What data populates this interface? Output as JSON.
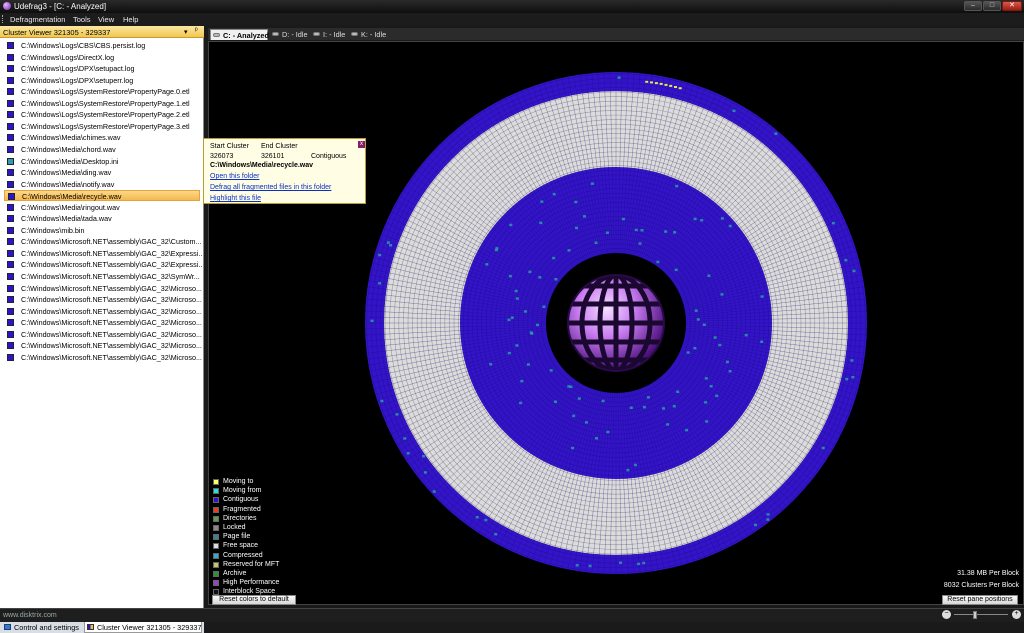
{
  "window": {
    "title": "Udefrag3 - [C: - Analyzed]",
    "min": "–",
    "max": "□",
    "close": "✕",
    "icon": "app-sphere-icon"
  },
  "menu": [
    "Defragmentation",
    "Tools",
    "View",
    "Help"
  ],
  "leftpane": {
    "title": "Cluster Viewer  321305 - 329337",
    "dropdown": "▾",
    "pin": "ᵖ",
    "files": [
      {
        "name": "C:\\Windows\\Logs\\CBS\\CBS.persist.log",
        "color": "#2b14c9"
      },
      {
        "name": "C:\\Windows\\Logs\\DirectX.log",
        "color": "#2b14c9"
      },
      {
        "name": "C:\\Windows\\Logs\\DPX\\setupact.log",
        "color": "#2b14c9"
      },
      {
        "name": "C:\\Windows\\Logs\\DPX\\setuperr.log",
        "color": "#2b14c9"
      },
      {
        "name": "C:\\Windows\\Logs\\SystemRestore\\PropertyPage.0.etl",
        "color": "#2b14c9"
      },
      {
        "name": "C:\\Windows\\Logs\\SystemRestore\\PropertyPage.1.etl",
        "color": "#2b14c9"
      },
      {
        "name": "C:\\Windows\\Logs\\SystemRestore\\PropertyPage.2.etl",
        "color": "#2b14c9"
      },
      {
        "name": "C:\\Windows\\Logs\\SystemRestore\\PropertyPage.3.etl",
        "color": "#2b14c9"
      },
      {
        "name": "C:\\Windows\\Media\\chimes.wav",
        "color": "#2b14c9"
      },
      {
        "name": "C:\\Windows\\Media\\chord.wav",
        "color": "#2b14c9"
      },
      {
        "name": "C:\\Windows\\Media\\Desktop.ini",
        "color": "#2a9fa8"
      },
      {
        "name": "C:\\Windows\\Media\\ding.wav",
        "color": "#2b14c9"
      },
      {
        "name": "C:\\Windows\\Media\\notify.wav",
        "color": "#2b14c9"
      },
      {
        "name": "C:\\Windows\\Media\\recycle.wav",
        "color": "#2b14c9"
      },
      {
        "name": "C:\\Windows\\Media\\ringout.wav",
        "color": "#2b14c9"
      },
      {
        "name": "C:\\Windows\\Media\\tada.wav",
        "color": "#2b14c9"
      },
      {
        "name": "C:\\Windows\\mib.bin",
        "color": "#2b14c9"
      },
      {
        "name": "C:\\Windows\\Microsoft.NET\\assembly\\GAC_32\\Custom...",
        "color": "#2b14c9"
      },
      {
        "name": "C:\\Windows\\Microsoft.NET\\assembly\\GAC_32\\Expressi...",
        "color": "#2b14c9"
      },
      {
        "name": "C:\\Windows\\Microsoft.NET\\assembly\\GAC_32\\Expressi...",
        "color": "#2b14c9"
      },
      {
        "name": "C:\\Windows\\Microsoft.NET\\assembly\\GAC_32\\SymWr...",
        "color": "#2b14c9"
      },
      {
        "name": "C:\\Windows\\Microsoft.NET\\assembly\\GAC_32\\Microso...",
        "color": "#2b14c9"
      },
      {
        "name": "C:\\Windows\\Microsoft.NET\\assembly\\GAC_32\\Microso...",
        "color": "#2b14c9"
      },
      {
        "name": "C:\\Windows\\Microsoft.NET\\assembly\\GAC_32\\Microso...",
        "color": "#2b14c9"
      },
      {
        "name": "C:\\Windows\\Microsoft.NET\\assembly\\GAC_32\\Microso...",
        "color": "#2b14c9"
      },
      {
        "name": "C:\\Windows\\Microsoft.NET\\assembly\\GAC_32\\Microso...",
        "color": "#2b14c9"
      },
      {
        "name": "C:\\Windows\\Microsoft.NET\\assembly\\GAC_32\\Microso...",
        "color": "#2b14c9"
      },
      {
        "name": "C:\\Windows\\Microsoft.NET\\assembly\\GAC_32\\Microso...",
        "color": "#2b14c9"
      }
    ],
    "selected_index": 13
  },
  "bottomtabs": [
    {
      "label": "Control and settings",
      "icon": "settings-icon"
    },
    {
      "label": "Cluster Viewer  321305 - 329337",
      "icon": "cluster-viewer-icon"
    }
  ],
  "drivetabs": [
    {
      "label": "C: - Analyzed",
      "icon": "drive-icon"
    },
    {
      "label": "D: - Idle",
      "icon": "drive-icon"
    },
    {
      "label": "I: - Idle",
      "icon": "drive-icon"
    },
    {
      "label": "K: - Idle",
      "icon": "drive-icon"
    }
  ],
  "tooltip": {
    "start_label": "Start Cluster",
    "end_label": "End Cluster",
    "start_value": "326073",
    "end_value": "326101",
    "status": "Contiguous",
    "file": "C:\\Windows\\Media\\recycle.wav",
    "link_open": "Open this folder",
    "link_defrag": "Defrag  all fragmented files in this folder",
    "link_highlight": "Highlight this file",
    "close": "x"
  },
  "legend": [
    {
      "label": "Moving to",
      "color": "#ffff66"
    },
    {
      "label": "Moving from",
      "color": "#22e0e0"
    },
    {
      "label": "Contiguous",
      "color": "#2b14c9"
    },
    {
      "label": "Fragmented",
      "color": "#e0401c"
    },
    {
      "label": "Directories",
      "color": "#5aa04c"
    },
    {
      "label": "Locked",
      "color": "#888888"
    },
    {
      "label": "Page file",
      "color": "#3a7f94"
    },
    {
      "label": "Free space",
      "color": "#dcdcdc"
    },
    {
      "label": "Compressed",
      "color": "#3aa6c8"
    },
    {
      "label": "Reserved for MFT",
      "color": "#c4c470"
    },
    {
      "label": "Archive",
      "color": "#2d8f3a"
    },
    {
      "label": "High Performance",
      "color": "#9a3ad8"
    },
    {
      "label": "Interblock Space",
      "color": "#111111"
    }
  ],
  "map": {
    "mb_per_block": "31.38 MB Per Block",
    "clusters_per_block": "8032 Clusters Per Block",
    "free_color": "#dcdcdc",
    "used_color": "#3314c8",
    "used_dark": "#2a0fa8",
    "highlight_color": "#25a8a0",
    "yellow_color": "#e8e84a"
  },
  "buttons": {
    "reset_colors": "Reset colors to default",
    "reset_panes": "Reset pane positions"
  },
  "status": {
    "url": "www.disktrix.com",
    "zoom_minus": "−",
    "zoom_plus": "+",
    "zoom_level": 0.35
  }
}
